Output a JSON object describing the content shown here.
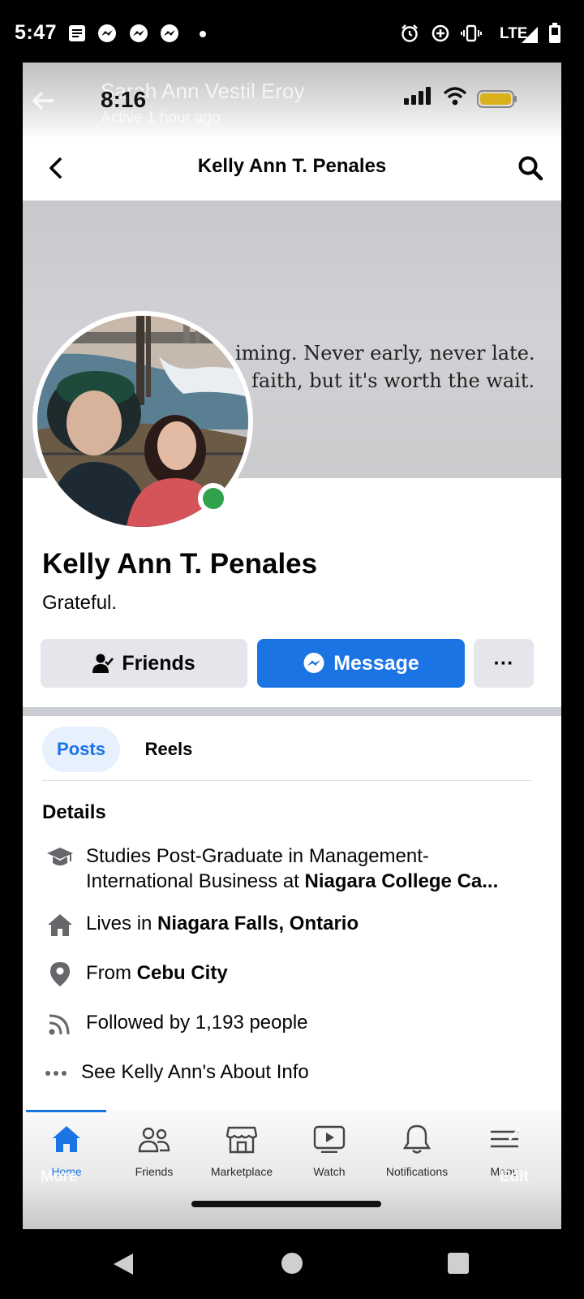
{
  "status_bar": {
    "time": "5:47",
    "network": "LTE",
    "icons": [
      "notes-icon",
      "messenger-icon",
      "messenger-icon",
      "messenger-icon",
      "dot-icon",
      "alarm-icon",
      "data-saver-icon",
      "vibrate-icon",
      "lte-signal-icon",
      "battery-icon"
    ]
  },
  "overlay": {
    "ghost_name": "Sarah Ann Vestil Eroy",
    "ghost_status": "Active 1 hour ago",
    "inner_time": "8:16"
  },
  "header": {
    "title": "Kelly Ann T. Penales"
  },
  "cover": {
    "line1": "iming. Never early, never late.",
    "line2": "faith, but it's worth the wait."
  },
  "profile": {
    "name": "Kelly Ann T. Penales",
    "bio": "Grateful.",
    "online": true,
    "online_color": "#31a24c"
  },
  "actions": {
    "friends_label": "Friends",
    "message_label": "Message",
    "more_label": "···"
  },
  "tabs": [
    {
      "label": "Posts",
      "active": true
    },
    {
      "label": "Reels",
      "active": false
    }
  ],
  "details": {
    "title": "Details",
    "study_prefix": "Studies Post-Graduate in Management-",
    "study_line2": "International Business at ",
    "study_school": "Niagara College Ca...",
    "lives_prefix": "Lives in ",
    "lives_place": "Niagara Falls, Ontario",
    "from_prefix": "From ",
    "from_place": "Cebu City",
    "followers": "Followed by 1,193 people",
    "about": "See Kelly Ann's About Info"
  },
  "bottom_nav": {
    "items": [
      {
        "label": "Home",
        "icon": "home-icon",
        "active": true
      },
      {
        "label": "Friends",
        "icon": "friends-icon",
        "active": false
      },
      {
        "label": "Marketplace",
        "icon": "marketplace-icon",
        "active": false
      },
      {
        "label": "Watch",
        "icon": "watch-icon",
        "active": false
      },
      {
        "label": "Notifications",
        "icon": "bell-icon",
        "active": false
      },
      {
        "label": "Menu",
        "icon": "menu-icon",
        "active": false
      }
    ],
    "ghost_more": "More",
    "ghost_edit": "Edit"
  },
  "colors": {
    "accent": "#1b74e4",
    "button_gray": "#e4e6eb",
    "tab_active_bg": "#e7f0fd"
  }
}
